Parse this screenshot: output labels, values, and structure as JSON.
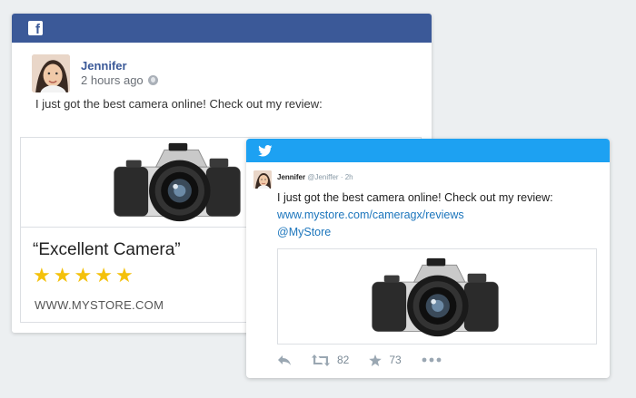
{
  "facebook": {
    "logo_letter": "f",
    "author": "Jennifer",
    "timestamp": "2 hours ago",
    "post_text": "I just got the best camera online! Check out my review:",
    "review_title": "“Excellent Camera”",
    "stars": 5,
    "star_glyph": "★",
    "domain": "WWW.MYSTORE.COM",
    "brand_color": "#3b5998"
  },
  "twitter": {
    "author": "Jennifer",
    "handle": "@Jeniffer",
    "separator": "·",
    "time": "2h",
    "tweet_text": "I just got the best camera online! Check out my review:",
    "link": "www.mystore.com/cameragx/reviews",
    "mention": "@MyStore",
    "retweet_count": "82",
    "favorite_count": "73",
    "brand_color": "#1da1f2",
    "link_color": "#1b75bc"
  },
  "icons": {
    "facebook_logo": "facebook-logo-icon",
    "twitter_logo": "twitter-bird-icon",
    "privacy": "globe-icon",
    "reply": "reply-icon",
    "retweet": "retweet-icon",
    "favorite": "star-icon",
    "more": "more-icon"
  }
}
